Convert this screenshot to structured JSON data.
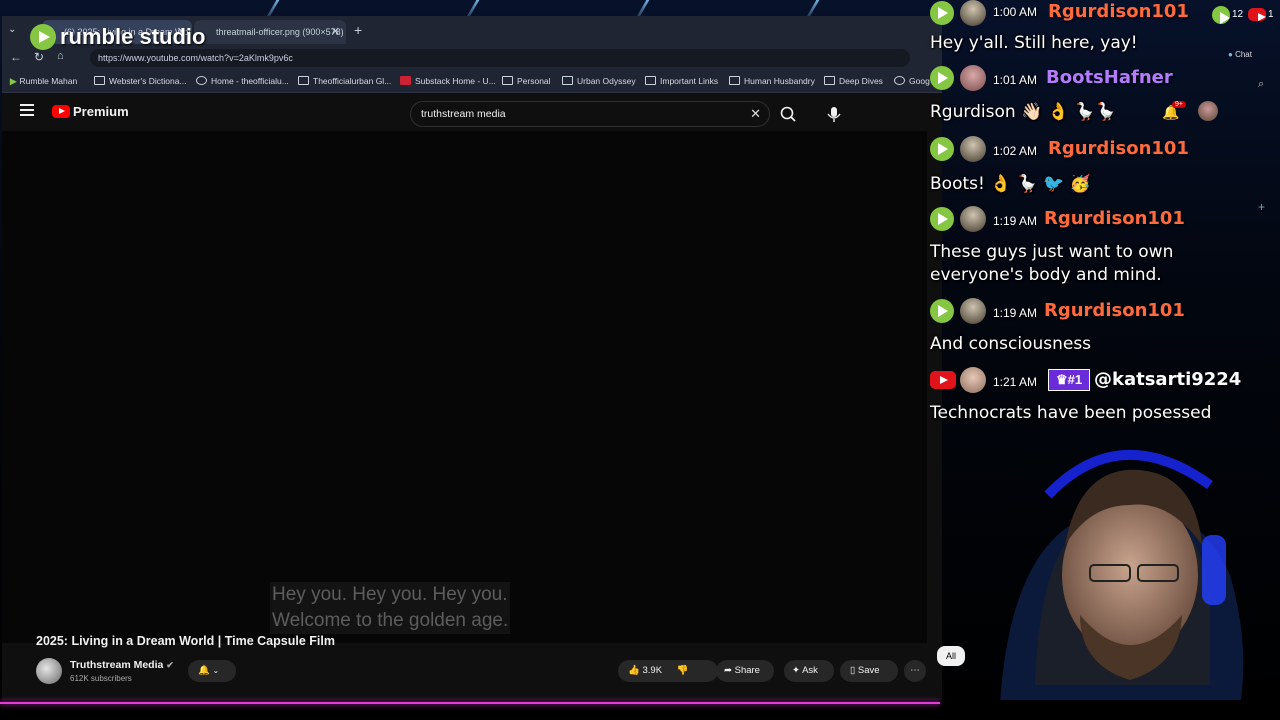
{
  "overlay": {
    "brand": "rumble studio",
    "counters": {
      "rumble": "12",
      "youtube": "1"
    }
  },
  "browser": {
    "tabs": [
      {
        "label": "(6) 2025: Living in a Dream World",
        "active": true
      },
      {
        "label": "threatmail-officer.png (900×578)",
        "active": false
      }
    ],
    "url": "https://www.youtube.com/watch?v=2aKlmk9pv6c",
    "bookmarks": [
      "Rumble Mahan",
      "Webster's Dictiona...",
      "Home - theofficialu...",
      "Theofficialurban Gl...",
      "Substack Home - U...",
      "Personal",
      "Urban Odyssey",
      "Important Links",
      "Human Husbandry",
      "Deep Dives",
      "Goog"
    ],
    "right_label": "Chat"
  },
  "youtube": {
    "logo": "Premium",
    "notif_count": "9+",
    "search_value": "truthstream media",
    "caption_lines": [
      "Hey you. Hey you. Hey you.",
      "Welcome to the golden age."
    ],
    "video_title": "2025: Living in a Dream World | Time Capsule Film",
    "channel": "Truthstream Media",
    "subscribers": "612K subscribers",
    "likes": "3.9K",
    "share": "Share",
    "ask": "Ask",
    "save": "Save",
    "chip": "All"
  },
  "chat": {
    "messages": [
      {
        "time": "1:00 AM",
        "user": "Rgurdison101",
        "text": "Hey y'all. Still here, yay!",
        "color": "#ff6a3d",
        "platform": "rumble"
      },
      {
        "time": "1:01 AM",
        "user": "BootsHafner",
        "text": "Rgurdison 👋🏻 👌 🪿🪿",
        "color": "#b57bff",
        "platform": "rumble"
      },
      {
        "time": "1:02 AM",
        "user": "Rgurdison101",
        "text": "Boots! 👌 🪿 🐦 🥳",
        "color": "#ff6a3d",
        "platform": "rumble"
      },
      {
        "time": "1:19 AM",
        "user": "Rgurdison101",
        "text": "These guys just want to own",
        "text2": "everyone's body and mind.",
        "color": "#ff6a3d",
        "platform": "rumble"
      },
      {
        "time": "1:19 AM",
        "user": "Rgurdison101",
        "text": "And consciousness",
        "color": "#ff6a3d",
        "platform": "rumble"
      },
      {
        "time": "1:21 AM",
        "user": "@katsarti9224",
        "badge": "#1",
        "text": "Technocrats have been posessed",
        "color": "#ffffff",
        "platform": "youtube"
      }
    ]
  }
}
